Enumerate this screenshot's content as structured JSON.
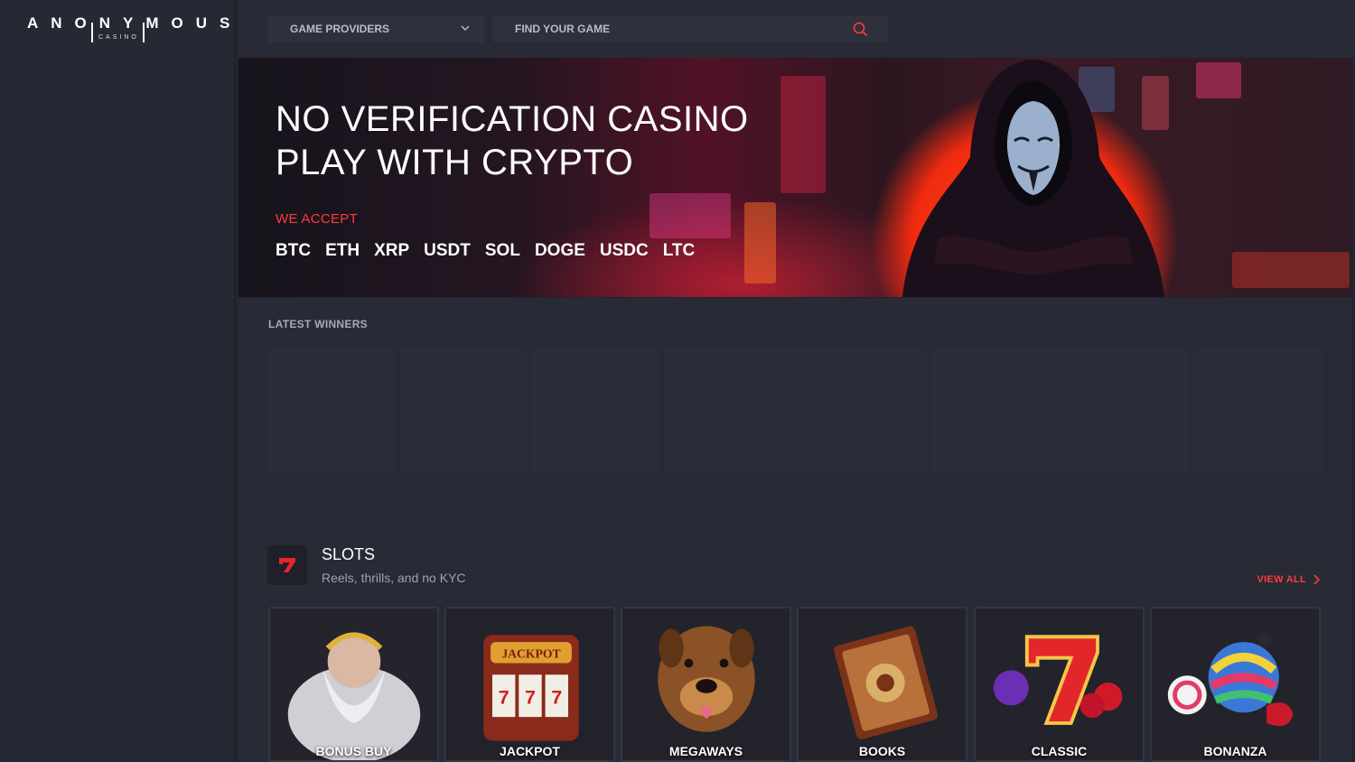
{
  "brand": {
    "name": "ANONYMOUS",
    "sub": "CASINO"
  },
  "topbar": {
    "providers_label": "GAME PROVIDERS",
    "search_placeholder": "FIND YOUR GAME"
  },
  "hero": {
    "line1": "NO VERIFICATION CASINO",
    "line2": "PLAY WITH CRYPTO",
    "accept_label": "WE ACCEPT",
    "coins": [
      "BTC",
      "ETH",
      "XRP",
      "USDT",
      "SOL",
      "DOGE",
      "USDC",
      "LTC"
    ]
  },
  "winners": {
    "title": "LATEST WINNERS"
  },
  "slots": {
    "title": "SLOTS",
    "subtitle": "Reels, thrills, and no KYC",
    "view_all": "VIEW ALL",
    "games": [
      {
        "label": "BONUS BUY",
        "icon": "zeus-icon"
      },
      {
        "label": "JACKPOT",
        "icon": "slot-machine-icon"
      },
      {
        "label": "MEGAWAYS",
        "icon": "dog-icon"
      },
      {
        "label": "BOOKS",
        "icon": "book-icon"
      },
      {
        "label": "CLASSIC",
        "icon": "seven-fruit-icon"
      },
      {
        "label": "BONANZA",
        "icon": "candy-bomb-icon"
      }
    ]
  },
  "colors": {
    "accent": "#ff3b3b",
    "bg": "#22242e",
    "panel": "#282a35"
  }
}
